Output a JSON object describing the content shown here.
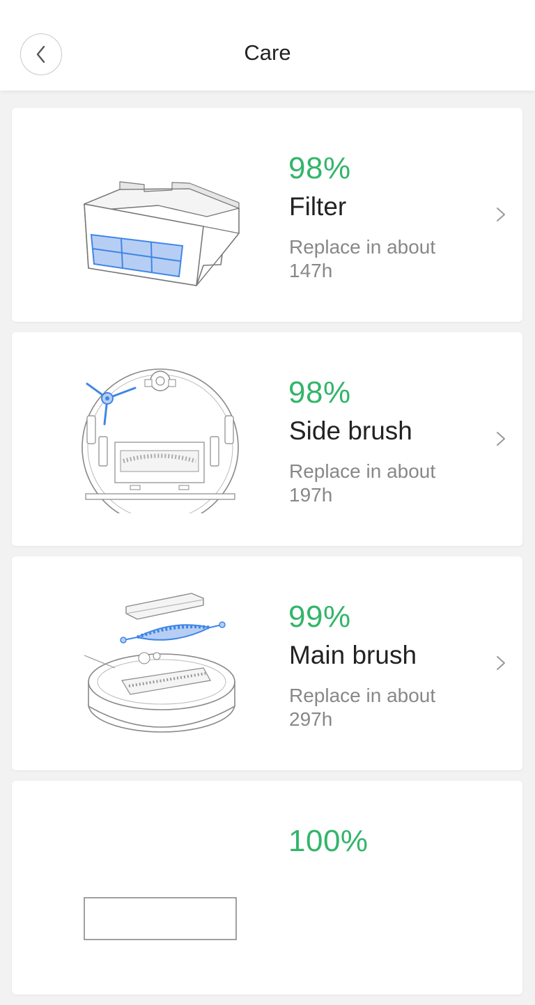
{
  "header": {
    "title": "Care"
  },
  "items": [
    {
      "percent": "98%",
      "name": "Filter",
      "replace_label": "Replace in about",
      "hours": "147h",
      "illustration": "filter-illustration"
    },
    {
      "percent": "98%",
      "name": "Side brush",
      "replace_label": "Replace in about",
      "hours": "197h",
      "illustration": "side-brush-illustration"
    },
    {
      "percent": "99%",
      "name": "Main brush",
      "replace_label": "Replace in about",
      "hours": "297h",
      "illustration": "main-brush-illustration"
    },
    {
      "percent": "100%"
    }
  ],
  "colors": {
    "percent": "#33b56a",
    "accent_blue": "#3f86e6",
    "background": "#f2f2f2"
  }
}
